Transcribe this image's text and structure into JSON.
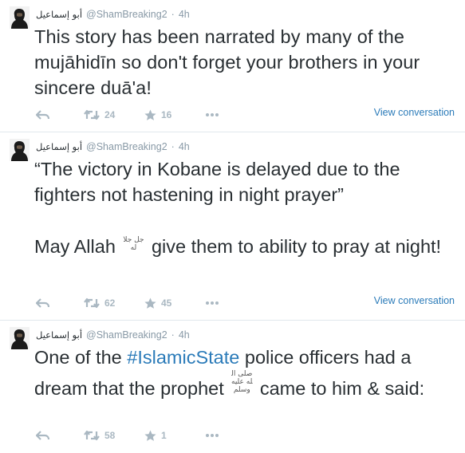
{
  "tweets": [
    {
      "display_name": "أبو إسماعيل",
      "handle": "@ShamBreaking2",
      "separator": "·",
      "time": "4h",
      "text_lines": [
        "This story has been narrated by many of the mujāhidīn so don't forget your brothers in your sincere duā'a!"
      ],
      "retweets": "24",
      "favorites": "16",
      "view_conversation": "View conversation"
    },
    {
      "display_name": "أبو إسماعيل",
      "handle": "@ShamBreaking2",
      "separator": "·",
      "time": "4h",
      "quote": "“The victory in Kobane is delayed due to the fighters not hastening in night prayer”",
      "line_a": "May Allah",
      "honorific": "جل جلاله",
      "line_b": "give them to ability to pray at night!",
      "retweets": "62",
      "favorites": "45",
      "view_conversation": "View conversation"
    },
    {
      "display_name": "أبو إسماعيل",
      "handle": "@ShamBreaking2",
      "separator": "·",
      "time": "4h",
      "pre": "One of the",
      "hashtag": "#IslamicState",
      "mid": "police officers had a dream that the prophet",
      "honorific": "صلى الله عليه وسلم",
      "post": "came to him & said:",
      "retweets": "58",
      "favorites": "1"
    }
  ],
  "icons": {
    "reply": "reply-arrow-icon",
    "retweet": "retweet-icon",
    "favorite": "star-icon",
    "more": "more-dots-icon"
  },
  "colors": {
    "link": "#2b7bb9",
    "muted": "#8899a6",
    "icon": "#aab8c2",
    "text": "#292f33"
  }
}
